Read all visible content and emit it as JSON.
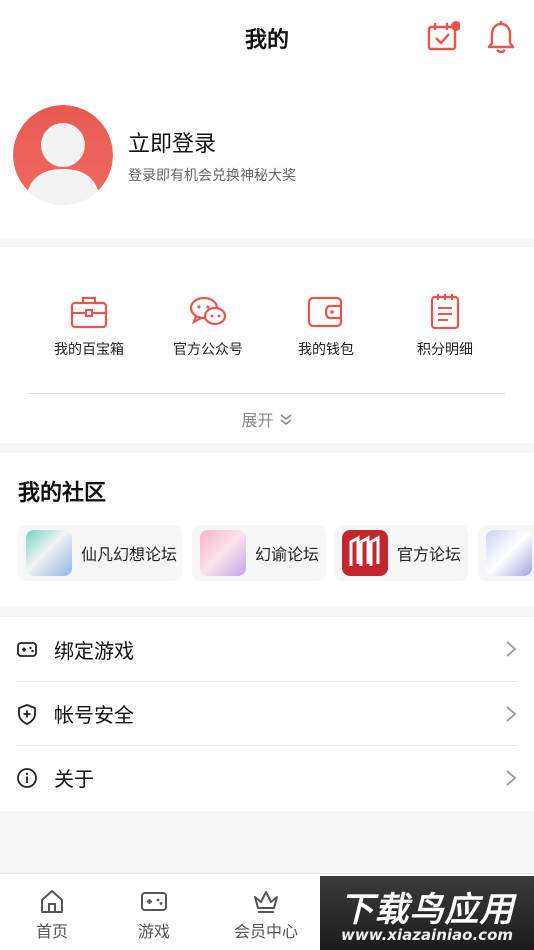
{
  "header": {
    "title": "我的",
    "checkin_icon": "calendar-check-icon",
    "bell_icon": "bell-icon"
  },
  "profile": {
    "login_title": "立即登录",
    "login_subtitle": "登录即有机会兑换神秘大奖"
  },
  "tools": {
    "items": [
      {
        "label": "我的百宝箱",
        "icon": "toolbox-icon"
      },
      {
        "label": "官方公众号",
        "icon": "wechat-icon"
      },
      {
        "label": "我的钱包",
        "icon": "wallet-icon"
      },
      {
        "label": "积分明细",
        "icon": "list-icon"
      }
    ],
    "expand_label": "展开",
    "expand_icon": "double-chevron-down-icon"
  },
  "community": {
    "title": "我的社区",
    "forums": [
      {
        "name": "仙凡幻想论坛"
      },
      {
        "name": "幻谕论坛"
      },
      {
        "name": "官方论坛"
      }
    ]
  },
  "menu": {
    "items": [
      {
        "label": "绑定游戏",
        "icon": "gamepad-icon"
      },
      {
        "label": "帐号安全",
        "icon": "shield-icon"
      },
      {
        "label": "关于",
        "icon": "info-icon"
      }
    ]
  },
  "tabbar": {
    "tabs": [
      {
        "label": "首页",
        "icon": "home-icon"
      },
      {
        "label": "游戏",
        "icon": "game-icon"
      },
      {
        "label": "会员中心",
        "icon": "crown-icon"
      }
    ]
  },
  "watermark": {
    "text": "下载鸟应用",
    "url": "www.xiazainiao.com"
  },
  "colors": {
    "accent": "#e8554f",
    "background": "#f5f5f5"
  }
}
